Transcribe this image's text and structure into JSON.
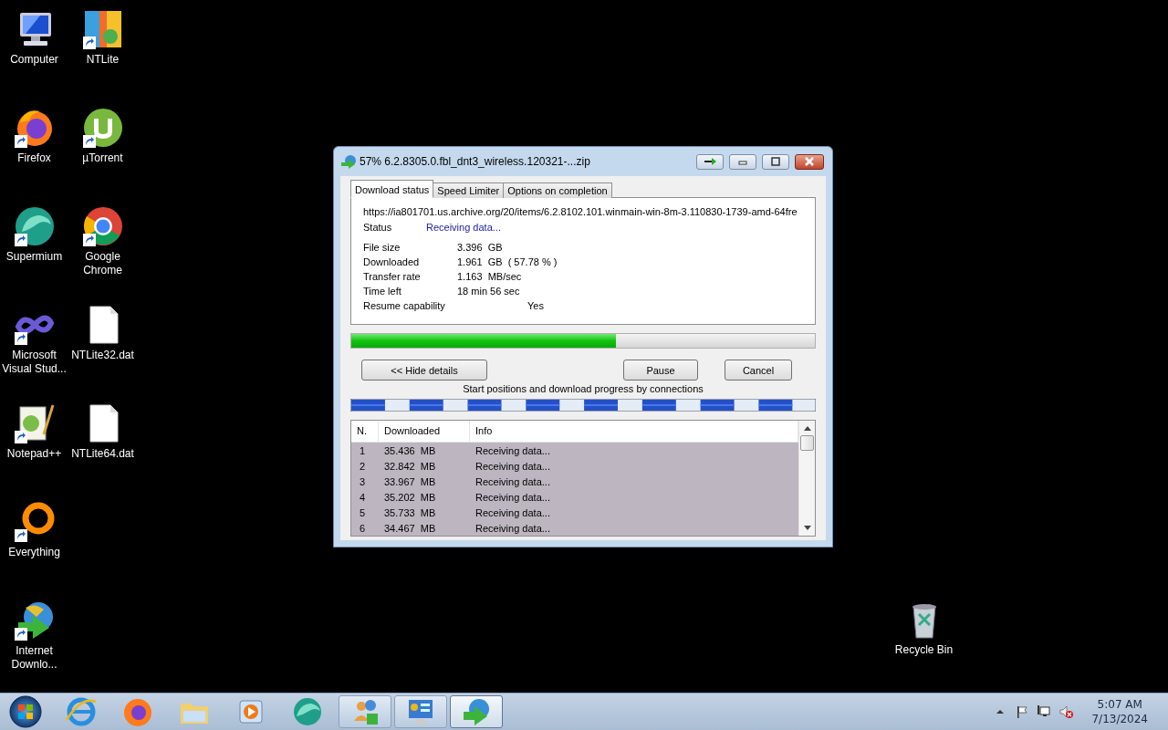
{
  "desktop": {
    "columns": [
      [
        {
          "label": "Computer",
          "kind": "computer",
          "shortcut": false
        },
        {
          "label": "Firefox",
          "kind": "firefox",
          "shortcut": true
        },
        {
          "label": "Supermium",
          "kind": "supermium",
          "shortcut": true
        },
        {
          "label": "Microsoft Visual Stud...",
          "kind": "vs",
          "shortcut": true
        },
        {
          "label": "Notepad++",
          "kind": "notepad",
          "shortcut": true
        },
        {
          "label": "Everything",
          "kind": "everything",
          "shortcut": true
        },
        {
          "label": "Internet Downlo...",
          "kind": "idm",
          "shortcut": true
        }
      ],
      [
        {
          "label": "NTLite",
          "kind": "ntlite",
          "shortcut": true
        },
        {
          "label": "µTorrent",
          "kind": "utorrent",
          "shortcut": true
        },
        {
          "label": "Google Chrome",
          "kind": "chrome",
          "shortcut": true
        },
        {
          "label": "NTLite32.dat",
          "kind": "file",
          "shortcut": false
        },
        {
          "label": "NTLite64.dat",
          "kind": "file",
          "shortcut": false
        }
      ]
    ],
    "recycle_bin": {
      "label": "Recycle Bin"
    }
  },
  "window": {
    "title": "57% 6.2.8305.0.fbl_dnt3_wireless.120321-...zip",
    "tabs": [
      {
        "label": "Download status",
        "selected": true
      },
      {
        "label": "Speed Limiter",
        "selected": false
      },
      {
        "label": "Options on completion",
        "selected": false
      }
    ],
    "url": "https://ia801701.us.archive.org/20/items/6.2.8102.101.winmain-win-8m-3.110830-1739-amd-64fre",
    "status": {
      "label": "Status",
      "value": "Receiving data..."
    },
    "details": [
      {
        "label": "File size",
        "value": "3.396  GB"
      },
      {
        "label": "Downloaded",
        "value": "1.961  GB  ( 57.78 % )"
      },
      {
        "label": "Transfer rate",
        "value": "1.163  MB/sec"
      },
      {
        "label": "Time left",
        "value": "18 min 56 sec"
      }
    ],
    "resume": {
      "label": "Resume capability",
      "value": "Yes"
    },
    "progress": {
      "level": 0.57
    },
    "buttons": {
      "details": "<< Hide details",
      "pause": "Pause",
      "cancel": "Cancel"
    },
    "connections_caption": "Start positions and download progress by connections",
    "table": {
      "columns": [
        "N.",
        "Downloaded",
        "Info"
      ],
      "rows": [
        {
          "n": "1",
          "downloaded": "35.436  MB",
          "info": "Receiving data...",
          "selected": true
        },
        {
          "n": "2",
          "downloaded": "32.842  MB",
          "info": "Receiving data...",
          "selected": true
        },
        {
          "n": "3",
          "downloaded": "33.967  MB",
          "info": "Receiving data...",
          "selected": true
        },
        {
          "n": "4",
          "downloaded": "35.202  MB",
          "info": "Receiving data...",
          "selected": true
        },
        {
          "n": "5",
          "downloaded": "35.733  MB",
          "info": "Receiving data...",
          "selected": true
        },
        {
          "n": "6",
          "downloaded": "34.467  MB",
          "info": "Receiving data...",
          "selected": true
        }
      ]
    }
  },
  "taskbar": {
    "pinned": [
      {
        "kind": "ie"
      },
      {
        "kind": "firefox"
      },
      {
        "kind": "explorer"
      },
      {
        "kind": "media"
      },
      {
        "kind": "supermium"
      }
    ],
    "running": [
      {
        "kind": "people",
        "active": false
      },
      {
        "kind": "control",
        "active": false
      },
      {
        "kind": "idm",
        "active": true
      }
    ],
    "clock": {
      "time": "5:07 AM",
      "date": "7/13/2024"
    }
  }
}
